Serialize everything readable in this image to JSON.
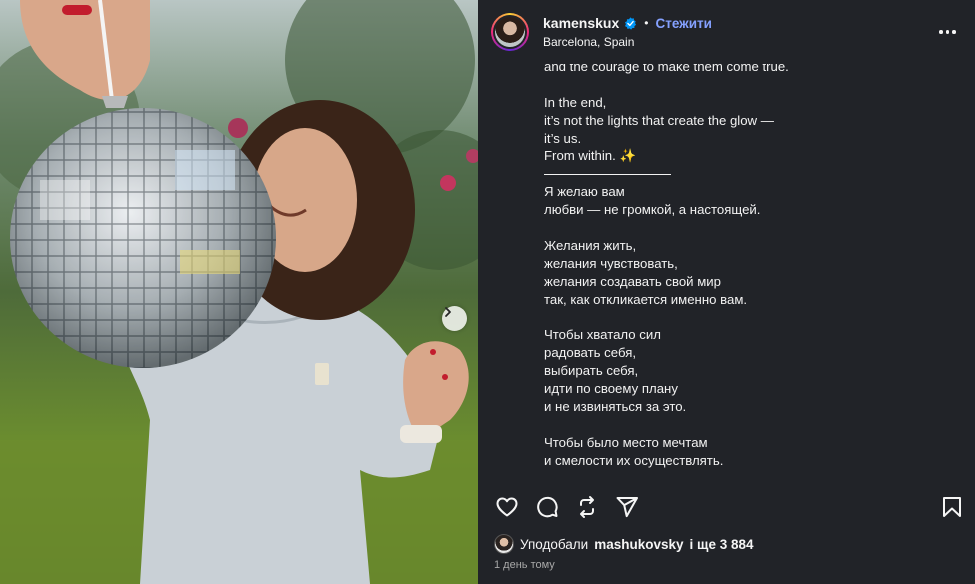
{
  "post": {
    "username": "kamenskux",
    "follow_label": "Стежити",
    "separator": "•",
    "location": "Barcelona, Spain",
    "verified_icon": "verified-badge-icon",
    "more_icon": "more-options-icon"
  },
  "caption": {
    "lines": [
      "and the courage to make them come true.",
      "",
      "In the end,",
      "it’s not the lights that create the glow —",
      "it’s us.",
      "From within. ✨",
      "__RULE__",
      "Я желаю вам",
      "любви — не громкой, а настоящей.",
      "",
      "Желания жить,",
      "желания чувствовать,",
      "желания создавать свой мир",
      "так, как откликается именно вам.",
      "",
      "Чтобы хватало сил",
      "радовать себя,",
      "выбирать себя,",
      "идти по своему плану",
      "и не извиняться за это.",
      "",
      "Чтобы было место мечтам",
      "и смелости их осуществлять.",
      ""
    ]
  },
  "actions": {
    "like_icon": "heart-icon",
    "comment_icon": "comment-icon",
    "repost_icon": "repost-icon",
    "share_icon": "send-icon",
    "save_icon": "bookmark-icon"
  },
  "likes": {
    "prefix": "Уподобали",
    "user": "mashukovsky",
    "suffix": "і ще 3 884"
  },
  "timestamp": "1 день тому",
  "carousel": {
    "next_icon": "chevron-right-icon"
  },
  "colors": {
    "panel_bg": "#212328",
    "accent_link": "#85a1ff",
    "verified": "#0095f6",
    "text": "#f5f5f5",
    "muted": "#a8a8a8"
  }
}
